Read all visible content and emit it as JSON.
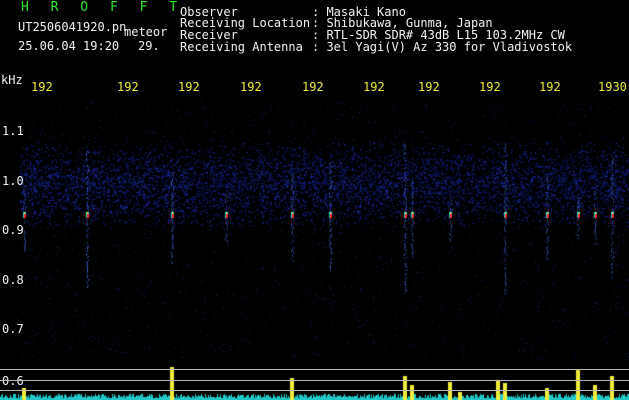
{
  "header": {
    "title": "H R O F F T",
    "filename": "UT2506041920.pn",
    "mode": "meteor",
    "datetime": "25.06.04 19:20",
    "count": "29.",
    "fields": [
      {
        "label": "Observer",
        "value": ": Masaki Kano"
      },
      {
        "label": "Receiving Location",
        "value": ": Shibukawa, Gunma, Japan"
      },
      {
        "label": "Receiver",
        "value": ": RTL-SDR SDR# 43dB L15 103.2MHz CW"
      },
      {
        "label": "Receiving Antenna",
        "value": ": 3el Yagi(V) Az 330 for Vladivostok"
      }
    ]
  },
  "axis": {
    "unit": "kHz",
    "y_ticks": [
      "1.1",
      "1.0",
      "0.9",
      "0.8",
      "0.7",
      "0.6"
    ],
    "time_ticks": [
      "192",
      "192",
      "192",
      "192",
      "192",
      "192",
      "192",
      "192",
      "192",
      "1930"
    ]
  },
  "colors": {
    "background": "#000000",
    "text": "#f2f2f2",
    "title": "#2ee82e",
    "ticks": "#f0ee3c",
    "noise": "#1a2a9a",
    "echo": "#ff2020",
    "baseline": "#20c8c8"
  }
}
